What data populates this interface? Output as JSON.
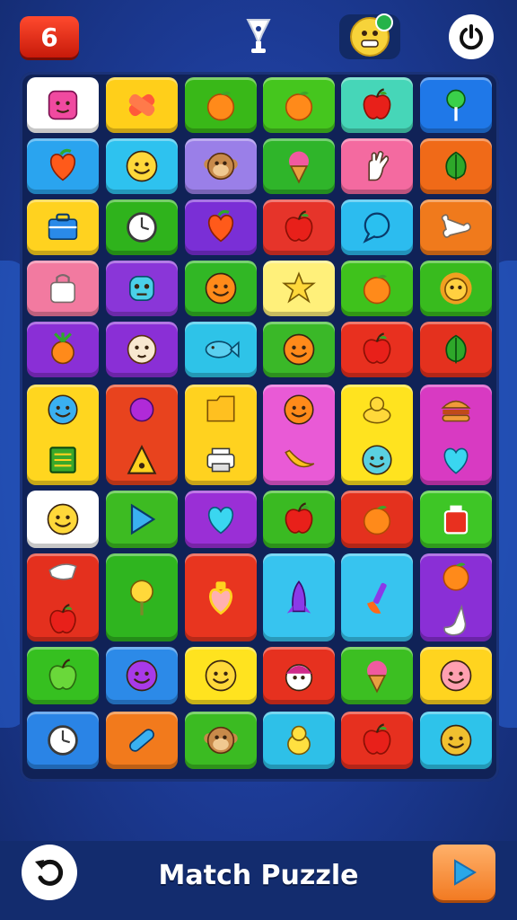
{
  "header": {
    "level": "6"
  },
  "footer": {
    "title": "Match Puzzle"
  },
  "board": {
    "columns": 6,
    "rows": [
      [
        {
          "color": "#ffffff",
          "icons": [
            "face-square-pink-icon"
          ]
        },
        {
          "color": "#ffcf1a",
          "icons": [
            "bandage-icon"
          ]
        },
        {
          "color": "#39b818",
          "icons": [
            "orange-fruit-icon"
          ]
        },
        {
          "color": "#45c61e",
          "icons": [
            "orange-fruit-icon"
          ]
        },
        {
          "color": "#46d6b8",
          "icons": [
            "apple-icon"
          ]
        },
        {
          "color": "#1f78e8",
          "icons": [
            "lollipop-icon"
          ]
        }
      ],
      [
        {
          "color": "#2aa4ef",
          "icons": [
            "heart-fruit-icon"
          ]
        },
        {
          "color": "#2ec2ef",
          "icons": [
            "smiley-face-icon"
          ]
        },
        {
          "color": "#9a7fe8",
          "icons": [
            "monkey-face-icon"
          ]
        },
        {
          "color": "#2fb52a",
          "icons": [
            "ice-cream-icon"
          ]
        },
        {
          "color": "#f46aa0",
          "icons": [
            "hand-icon"
          ]
        },
        {
          "color": "#f06a18",
          "icons": [
            "leaf-icon"
          ]
        }
      ],
      [
        {
          "color": "#ffd21f",
          "icons": [
            "briefcase-icon"
          ]
        },
        {
          "color": "#2fb31c",
          "icons": [
            "clock-icon"
          ]
        },
        {
          "color": "#7a2fd6",
          "icons": [
            "heart-fruit-icon"
          ]
        },
        {
          "color": "#e6342a",
          "icons": [
            "apple-icon"
          ]
        },
        {
          "color": "#2cbcef",
          "icons": [
            "speech-bubble-icon"
          ]
        },
        {
          "color": "#f07a1c",
          "icons": [
            "bone-icon"
          ]
        }
      ],
      [
        {
          "color": "#f27aa0",
          "icons": [
            "bag-icon"
          ]
        },
        {
          "color": "#8a36d8",
          "icons": [
            "robot-face-icon"
          ]
        },
        {
          "color": "#31b725",
          "icons": [
            "orange-face-icon"
          ]
        },
        {
          "color": "#fff07a",
          "icons": [
            "star-icon"
          ]
        },
        {
          "color": "#3fc21c",
          "icons": [
            "orange-fruit-icon"
          ]
        },
        {
          "color": "#38bb1e",
          "icons": [
            "lion-face-icon"
          ]
        }
      ],
      [
        {
          "color": "#8a2fd6",
          "icons": [
            "carrot-icon"
          ]
        },
        {
          "color": "#8a2fd6",
          "icons": [
            "sloth-face-icon"
          ]
        },
        {
          "color": "#2ec3e8",
          "icons": [
            "fish-icon"
          ]
        },
        {
          "color": "#3ab828",
          "icons": [
            "orange-face-icon"
          ]
        },
        {
          "color": "#e8301f",
          "icons": [
            "apple-icon"
          ]
        },
        {
          "color": "#e4311e",
          "icons": [
            "leaf-icon"
          ]
        }
      ],
      [
        {
          "color": "#ffd61f",
          "icons": [
            "blue-face-icon",
            "list-icon"
          ]
        },
        {
          "color": "#e8431e",
          "icons": [
            "ball-icon",
            "warning-triangle-icon"
          ]
        },
        {
          "color": "#ffd21f",
          "icons": [
            "folder-icon",
            "printer-icon"
          ]
        },
        {
          "color": "#e95ad6",
          "icons": [
            "orange-face-icon",
            "banana-icon"
          ]
        },
        {
          "color": "#ffe31f",
          "icons": [
            "duck-icon",
            "apple-face-icon"
          ]
        },
        {
          "color": "#d83ac2",
          "icons": [
            "burger-icon",
            "heart-icon"
          ]
        }
      ],
      [
        {
          "color": "#ffffff",
          "icons": [
            "smiley-face-icon"
          ]
        },
        {
          "color": "#3dbb22",
          "icons": [
            "play-arrow-icon"
          ]
        },
        {
          "color": "#9a2fd6",
          "icons": [
            "heart-icon"
          ]
        },
        {
          "color": "#3aba22",
          "icons": [
            "apple-icon"
          ]
        },
        {
          "color": "#e4311e",
          "icons": [
            "orange-fruit-icon"
          ]
        },
        {
          "color": "#3ec626",
          "icons": [
            "jar-icon"
          ]
        }
      ],
      [
        {
          "color": "#e4301e",
          "icons": [
            "paper-icon",
            "apple-icon"
          ]
        },
        {
          "color": "#2fb51f",
          "icons": [
            "flower-icon"
          ]
        },
        {
          "color": "#e8351f",
          "icons": [
            "heart-potion-icon"
          ]
        },
        {
          "color": "#37c4ef",
          "icons": [
            "rocket-icon"
          ]
        },
        {
          "color": "#37c4ef",
          "icons": [
            "brush-icon"
          ]
        },
        {
          "color": "#8a2fd6",
          "icons": [
            "orange-fruit-icon",
            "sock-icon"
          ]
        }
      ],
      [
        {
          "color": "#36c020",
          "icons": [
            "green-apple-icon"
          ]
        },
        {
          "color": "#2c8ae8",
          "icons": [
            "purple-face-icon"
          ]
        },
        {
          "color": "#ffe31f",
          "icons": [
            "smiley-face-icon"
          ]
        },
        {
          "color": "#e6311f",
          "icons": [
            "girl-face-icon"
          ]
        },
        {
          "color": "#3cbf22",
          "icons": [
            "ice-cream-icon"
          ]
        },
        {
          "color": "#ffd41f",
          "icons": [
            "pig-face-icon"
          ]
        }
      ],
      [
        {
          "color": "#2a84e6",
          "icons": [
            "clock-icon"
          ]
        },
        {
          "color": "#f27a1c",
          "icons": [
            "pill-icon"
          ]
        },
        {
          "color": "#3bbb22",
          "icons": [
            "monkey-face-icon"
          ]
        },
        {
          "color": "#2ec0e8",
          "icons": [
            "chick-icon"
          ]
        },
        {
          "color": "#e6301f",
          "icons": [
            "apple-icon"
          ]
        },
        {
          "color": "#2ec3ea",
          "icons": [
            "potato-face-icon"
          ]
        }
      ]
    ]
  },
  "icons": {
    "level_badge": "level-badge-icon",
    "trophy": "trophy-icon",
    "avatar": "avatar-icon",
    "power": "power-icon",
    "undo": "undo-icon",
    "play": "play-icon"
  }
}
